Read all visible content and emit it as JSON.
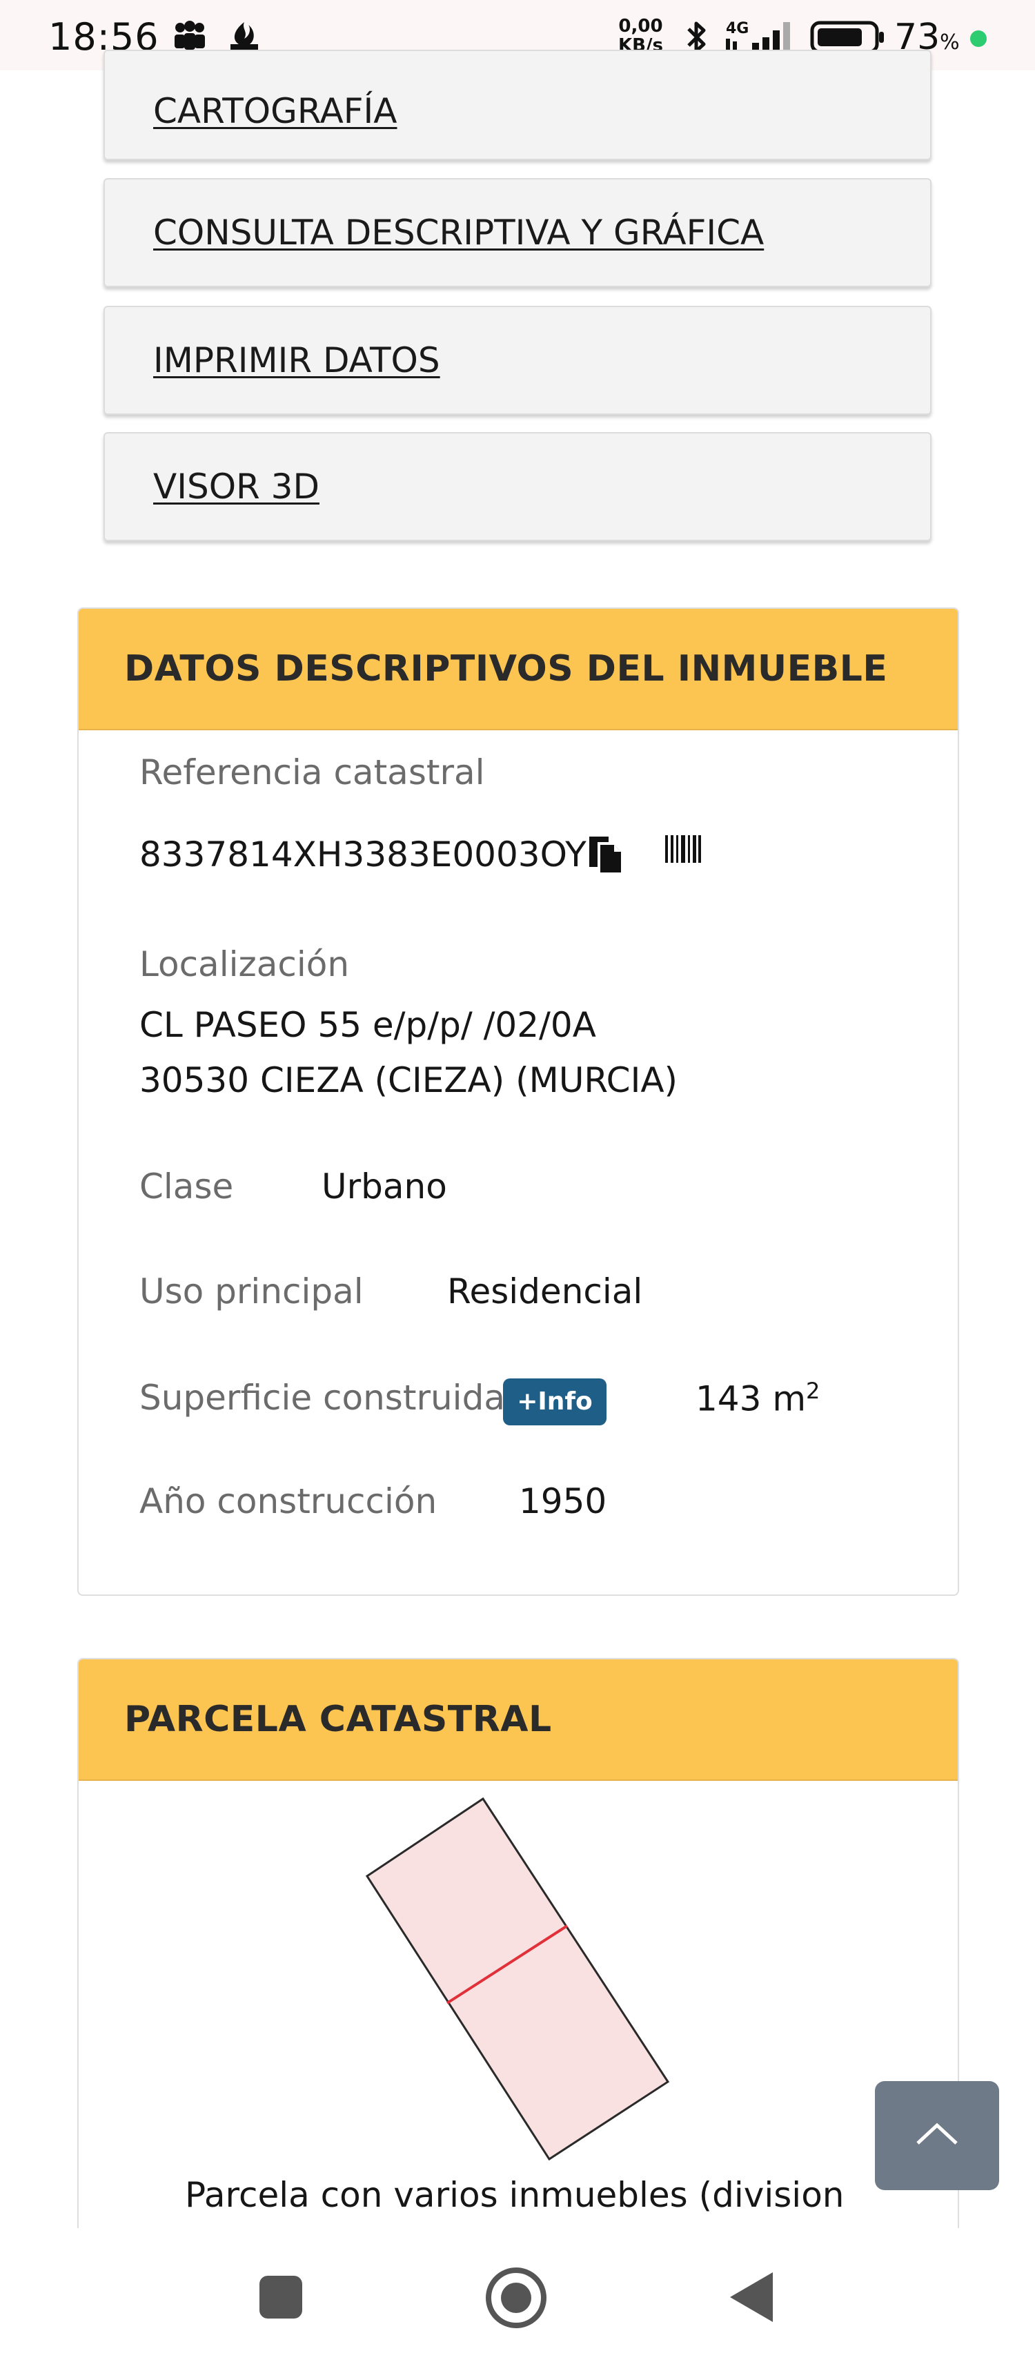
{
  "status_bar": {
    "time": "18:56",
    "net_speed_value": "0,00",
    "net_speed_unit": "KB/s",
    "network_type": "4G",
    "battery_percent": "73",
    "battery_percent_sign": "%"
  },
  "menu": {
    "items": [
      {
        "label": "CARTOGRAFÍA"
      },
      {
        "label": "CONSULTA DESCRIPTIVA Y GRÁFICA"
      },
      {
        "label": "IMPRIMIR DATOS"
      },
      {
        "label": "VISOR 3D"
      }
    ]
  },
  "datos": {
    "title": "DATOS DESCRIPTIVOS DEL INMUEBLE",
    "ref_label": "Referencia catastral",
    "ref_value": "8337814XH3383E0003OY",
    "loc_label": "Localización",
    "loc_line1": "CL PASEO 55 e/p/p/ /02/0A",
    "loc_line2": "30530 CIEZA (CIEZA) (MURCIA)",
    "clase_label": "Clase",
    "clase_value": "Urbano",
    "uso_label": "Uso principal",
    "uso_value": "Residencial",
    "sup_label": "Superficie construida",
    "sup_info": "+Info",
    "sup_value": "143 m",
    "sup_unit_sup": "2",
    "anio_label": "Año construcción",
    "anio_value": "1950"
  },
  "parcela": {
    "title": "PARCELA CATASTRAL",
    "caption": "Parcela con varios inmuebles (division horizontal)"
  },
  "icons": {
    "copy": "copy-icon",
    "barcode": "barcode-icon",
    "scroll_top": "chevron-up-icon",
    "nav_recents": "square-icon",
    "nav_home": "circle-icon",
    "nav_back": "triangle-back-icon"
  },
  "colors": {
    "panel_header": "#fcc451",
    "info_badge": "#1f5e86",
    "parcel_fill": "#f9e1e1",
    "parcel_divider": "#e0303a"
  }
}
